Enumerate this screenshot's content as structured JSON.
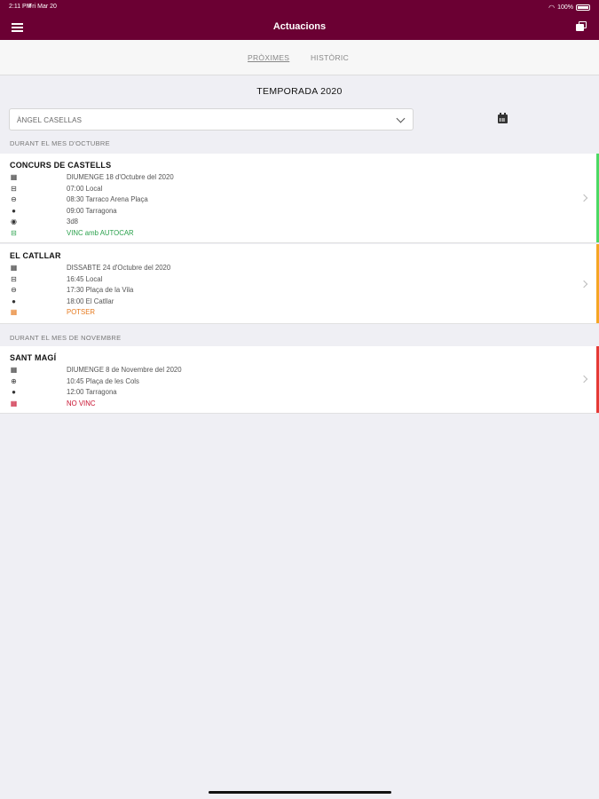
{
  "status_bar": {
    "time": "2:11 PM",
    "date": "Fri Mar 20",
    "battery": "100%"
  },
  "header": {
    "title": "Actuacions",
    "menu_icon": "menu-icon",
    "right_icon": "copy-icon"
  },
  "tabs": [
    {
      "label": "PRÒXIMES",
      "active": true
    },
    {
      "label": "HISTÒRIC",
      "active": false
    }
  ],
  "season_title": "TEMPORADA 2020",
  "member_select": {
    "value": "ÀNGEL CASELLAS"
  },
  "sections": [
    {
      "title": "DURANT EL MES D'OCTUBRE",
      "events": [
        {
          "title": "CONCURS DE CASTELLS",
          "status_color": "#4cd964",
          "rows": [
            {
              "icon": "calendar-icon",
              "text": "DIUMENGE 18 d'Octubre del 2020"
            },
            {
              "icon": "bus-icon",
              "text": "07:00 Local"
            },
            {
              "icon": "car-icon",
              "text": "08:30 Tarraco Arena Plaça"
            },
            {
              "icon": "location-pin-icon",
              "text": "09:00 Tarragona"
            },
            {
              "icon": "target-icon",
              "text": "3d8"
            },
            {
              "icon": "bus-icon",
              "text": "VINC amb AUTOCAR",
              "status": "green"
            }
          ]
        },
        {
          "title": "EL CATLLAR",
          "status_color": "#f5a623",
          "rows": [
            {
              "icon": "calendar-icon",
              "text": "DISSABTE 24 d'Octubre del 2020"
            },
            {
              "icon": "bus-icon",
              "text": "16:45 Local"
            },
            {
              "icon": "car-icon",
              "text": "17:30 Plaça de la Vila"
            },
            {
              "icon": "location-pin-icon",
              "text": "18:00 El Catllar"
            },
            {
              "icon": "calendar-question-icon",
              "text": "POTSER",
              "status": "orange"
            }
          ]
        }
      ]
    },
    {
      "title": "DURANT EL MES DE NOVEMBRE",
      "events": [
        {
          "title": "SANT MAGÍ",
          "status_color": "#e53935",
          "rows": [
            {
              "icon": "calendar-icon",
              "text": "DIUMENGE 8 de Novembre del 2020"
            },
            {
              "icon": "gps-icon",
              "text": "10:45 Plaça de les Cols"
            },
            {
              "icon": "location-pin-icon",
              "text": "12:00 Tarragona"
            },
            {
              "icon": "calendar-x-icon",
              "text": "NO VINC",
              "status": "red"
            }
          ]
        }
      ]
    }
  ]
}
